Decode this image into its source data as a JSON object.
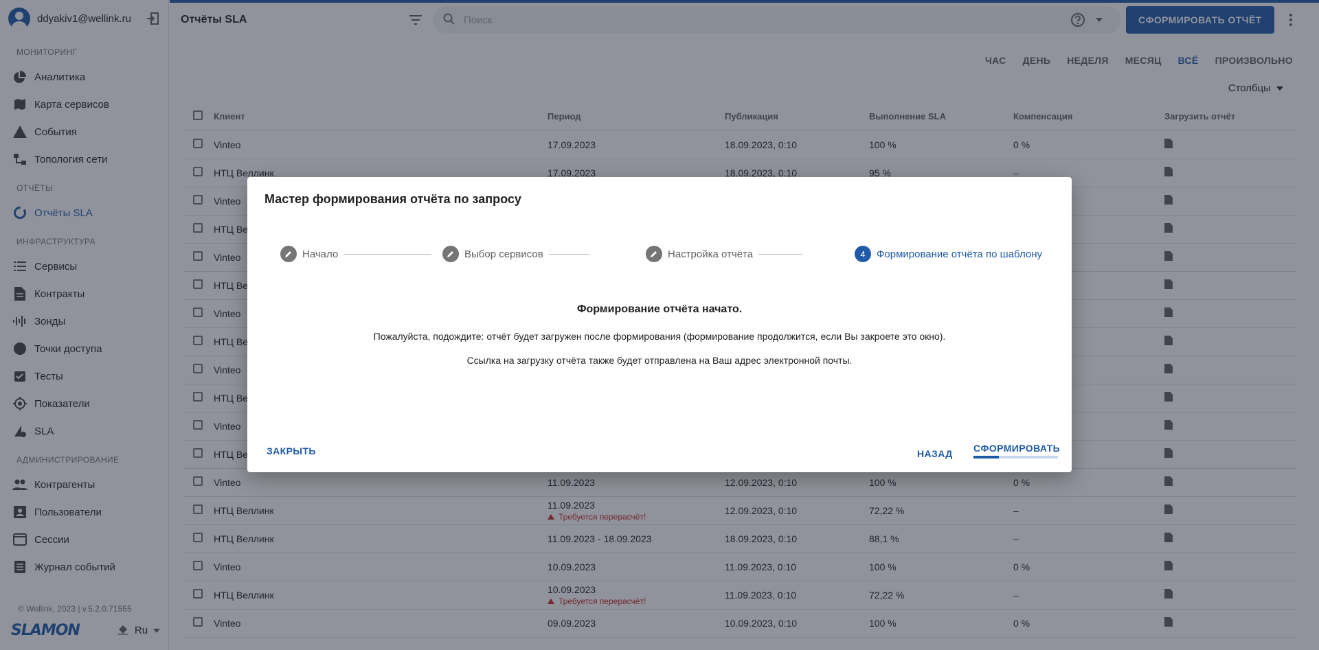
{
  "user": {
    "email": "ddyakiv1@wellink.ru"
  },
  "sidebar": {
    "sections": [
      {
        "title": "МОНИТОРИНГ",
        "items": [
          {
            "label": "Аналитика",
            "icon": "pie-chart-icon"
          },
          {
            "label": "Карта сервисов",
            "icon": "map-icon"
          },
          {
            "label": "События",
            "icon": "warning-icon"
          },
          {
            "label": "Топология сети",
            "icon": "topology-icon"
          }
        ]
      },
      {
        "title": "ОТЧЁТЫ",
        "items": [
          {
            "label": "Отчёты SLA",
            "icon": "report-circle-icon",
            "active": true
          }
        ]
      },
      {
        "title": "ИНФРАСТРУКТУРА",
        "items": [
          {
            "label": "Сервисы",
            "icon": "list-icon"
          },
          {
            "label": "Контракты",
            "icon": "document-icon"
          },
          {
            "label": "Зонды",
            "icon": "probe-icon"
          },
          {
            "label": "Точки доступа",
            "icon": "circle-icon"
          },
          {
            "label": "Тесты",
            "icon": "checklist-icon"
          },
          {
            "label": "Показатели",
            "icon": "gauge-icon"
          },
          {
            "label": "SLA",
            "icon": "sla-icon"
          }
        ]
      },
      {
        "title": "АДМИНИСТРИРОВАНИЕ",
        "items": [
          {
            "label": "Контрагенты",
            "icon": "people-icon"
          },
          {
            "label": "Пользователи",
            "icon": "user-card-icon"
          },
          {
            "label": "Сессии",
            "icon": "window-icon"
          },
          {
            "label": "Журнал событий",
            "icon": "journal-icon"
          }
        ]
      }
    ],
    "footer": "© Wellink, 2023 | v.5.2.0.71555",
    "logo": "SLAMON",
    "language": "Ru"
  },
  "topbar": {
    "title": "Отчёты SLA",
    "search_placeholder": "Поиск",
    "primary_button": "СФОРМИРОВАТЬ ОТЧЁТ"
  },
  "periods": [
    "ЧАС",
    "ДЕНЬ",
    "НЕДЕЛЯ",
    "МЕСЯЦ",
    "ВСЁ",
    "ПРОИЗВОЛЬНО"
  ],
  "active_period": "ВСЁ",
  "columns_button": "Столбцы",
  "table": {
    "headers": [
      "Клиент",
      "Период",
      "Публикация",
      "Выполнение SLA",
      "Компенсация",
      "Загрузить отчёт"
    ],
    "rows": [
      {
        "client": "Vinteo",
        "period": "17.09.2023",
        "pub": "18.09.2023, 0:10",
        "sla": "100 %",
        "comp": "0 %"
      },
      {
        "client": "НТЦ Веллинк",
        "period": "17.09.2023",
        "pub": "18.09.2023, 0:10",
        "sla": "95 %",
        "comp": "–"
      },
      {
        "client": "Vinteo",
        "period": "",
        "pub": "",
        "sla": "",
        "comp": ""
      },
      {
        "client": "НТЦ Веллинк",
        "period": "",
        "pub": "",
        "sla": "",
        "comp": ""
      },
      {
        "client": "Vinteo",
        "period": "",
        "pub": "",
        "sla": "",
        "comp": ""
      },
      {
        "client": "НТЦ Веллинк",
        "period": "",
        "pub": "",
        "sla": "",
        "comp": ""
      },
      {
        "client": "Vinteo",
        "period": "",
        "pub": "",
        "sla": "",
        "comp": ""
      },
      {
        "client": "НТЦ Веллинк",
        "period": "",
        "pub": "",
        "sla": "",
        "comp": ""
      },
      {
        "client": "Vinteo",
        "period": "",
        "pub": "",
        "sla": "",
        "comp": ""
      },
      {
        "client": "НТЦ Веллинк",
        "period": "",
        "pub": "",
        "sla": "",
        "comp": ""
      },
      {
        "client": "Vinteo",
        "period": "",
        "pub": "",
        "sla": "",
        "comp": ""
      },
      {
        "client": "НТЦ Веллинк",
        "period": "",
        "pub": "",
        "sla": "",
        "comp": ""
      },
      {
        "client": "Vinteo",
        "period": "11.09.2023",
        "pub": "12.09.2023, 0:10",
        "sla": "100 %",
        "comp": "0 %"
      },
      {
        "client": "НТЦ Веллинк",
        "period": "11.09.2023",
        "warning": "Требуется перерасчёт!",
        "pub": "12.09.2023, 0:10",
        "sla": "72,22 %",
        "comp": "–"
      },
      {
        "client": "НТЦ Веллинк",
        "period": "11.09.2023 - 18.09.2023",
        "pub": "18.09.2023, 0:10",
        "sla": "88,1 %",
        "comp": "–"
      },
      {
        "client": "Vinteo",
        "period": "10.09.2023",
        "pub": "11.09.2023, 0:10",
        "sla": "100 %",
        "comp": "0 %"
      },
      {
        "client": "НТЦ Веллинк",
        "period": "10.09.2023",
        "warning": "Требуется перерасчёт!",
        "pub": "11.09.2023, 0:10",
        "sla": "72,22 %",
        "comp": "–"
      },
      {
        "client": "Vinteo",
        "period": "09.09.2023",
        "pub": "10.09.2023, 0:10",
        "sla": "100 %",
        "comp": "0 %"
      }
    ]
  },
  "modal": {
    "title": "Мастер формирования отчёта по запросу",
    "steps": [
      {
        "label": "Начало",
        "marker": "edit"
      },
      {
        "label": "Выбор сервисов",
        "marker": "edit"
      },
      {
        "label": "Настройка отчёта",
        "marker": "edit"
      },
      {
        "label": "Формирование отчёта по шаблону",
        "marker": "4",
        "active": true
      }
    ],
    "heading": "Формирование отчёта начато.",
    "message1": "Пожалуйста, подождите: отчёт будет загружен после формирования (формирование продолжится, если Вы закроете это окно).",
    "message2": "Ссылка на загрузку отчёта также будет отправлена на Ваш адрес электронной почты.",
    "close_button": "ЗАКРЫТЬ",
    "back_button": "НАЗАД",
    "submit_button": "СФОРМИРОВАТЬ",
    "progress": 0.3
  },
  "colors": {
    "accent": "#1e5aa8",
    "warning": "#c62828",
    "overlay": "rgba(33,39,55,0.5)"
  }
}
